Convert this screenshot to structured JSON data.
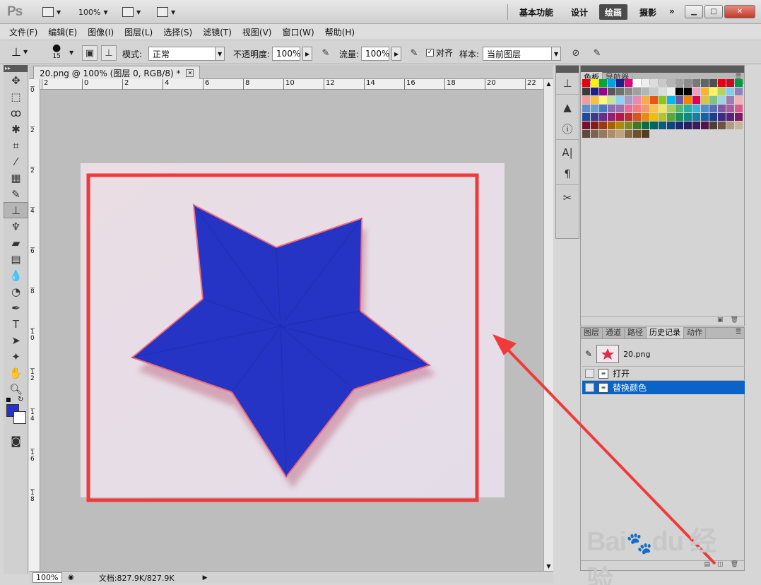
{
  "app": {
    "logo": "Ps",
    "zoom": "100%",
    "workspaces": [
      "基本功能",
      "设计",
      "绘画",
      "摄影"
    ],
    "active_workspace": "绘画",
    "more": "»"
  },
  "menu": [
    "文件(F)",
    "编辑(E)",
    "图像(I)",
    "图层(L)",
    "选择(S)",
    "滤镜(T)",
    "视图(V)",
    "窗口(W)",
    "帮助(H)"
  ],
  "options": {
    "brush_size": "15",
    "mode_label": "模式:",
    "mode_value": "正常",
    "opacity_label": "不透明度:",
    "opacity_value": "100%",
    "flow_label": "流量:",
    "flow_value": "100%",
    "aligned_label": "对齐",
    "sample_label": "样本:",
    "sample_value": "当前图层"
  },
  "document": {
    "tab_title": "20.png @ 100% (图层 0, RGB/8) *",
    "ruler_h": [
      "2",
      "0",
      "2",
      "4",
      "6",
      "8",
      "10",
      "12",
      "14",
      "16",
      "18",
      "20",
      "22"
    ],
    "ruler_v": [
      "0",
      "2",
      "2",
      "4",
      "6",
      "8",
      "1\n0",
      "1\n2",
      "1\n4",
      "1\n6",
      "1\n8"
    ],
    "status_zoom": "100%",
    "status_doc": "文档:827.9K/827.9K"
  },
  "panels": {
    "swatches_tabs": [
      "色板",
      "导航器"
    ],
    "history_tabs": [
      "图层",
      "通道",
      "路径",
      "历史记录",
      "动作"
    ],
    "snapshot_name": "20.png",
    "history_items": [
      "打开",
      "替换颜色"
    ],
    "selected_history": "替换颜色"
  },
  "swatch_colors": [
    "#e60012",
    "#fff100",
    "#00a73c",
    "#00a0e9",
    "#1d2088",
    "#e4007f",
    "#ffffff",
    "#eeeeee",
    "#dcdcdc",
    "#c9c9c9",
    "#b5b5b5",
    "#a0a0a0",
    "#8c8c8c",
    "#787878",
    "#646464",
    "#505050",
    "#e60012",
    "#c30d23",
    "#009944",
    "#3e3a39",
    "#1d2088",
    "#920783",
    "#595757",
    "#727171",
    "#898989",
    "#9fa0a0",
    "#b5b5b6",
    "#c9caca",
    "#dcdddd",
    "#efefef",
    "#000000",
    "#000000",
    "#f19ec2",
    "#f8b62d",
    "#fff45c",
    "#b3d465",
    "#7ecef4",
    "#8f82bc",
    "#f29c9f",
    "#fac03d",
    "#fff67f",
    "#c7e2a2",
    "#8cd3f5",
    "#a59aca",
    "#ee87b4",
    "#f6ad49",
    "#ea5514",
    "#8fc31f",
    "#00b7ee",
    "#6a5aa3",
    "#f08300",
    "#e5004f",
    "#d7c447",
    "#7cc28d",
    "#a3d2e2",
    "#9e7bb5",
    "#f5b2b2",
    "#5f8ec9",
    "#6a9fd1",
    "#4c7bbd",
    "#8a70b0",
    "#a06fae",
    "#e86b9a",
    "#f37c7c",
    "#f29a6c",
    "#fbc24f",
    "#f0e85a",
    "#a8cf58",
    "#57b770",
    "#2aaea5",
    "#38b5d8",
    "#4e8fcc",
    "#5b6db4",
    "#7b5aa6",
    "#a85b9f",
    "#d85a8e",
    "#1f4a9a",
    "#3d3a8f",
    "#6a2c8c",
    "#8e2471",
    "#b5184c",
    "#c72b2b",
    "#d9531e",
    "#e98b11",
    "#eebc0c",
    "#b8c224",
    "#5aa83a",
    "#16925a",
    "#0c8b85",
    "#137fa8",
    "#1b5f9f",
    "#243b8a",
    "#3d2b82",
    "#5a2379",
    "#7d1c63",
    "#7a0f2e",
    "#8a1a16",
    "#9a3a10",
    "#a5600a",
    "#a98b05",
    "#7d8c15",
    "#3e7a2a",
    "#0f6b46",
    "#08645f",
    "#0c5b7a",
    "#12437a",
    "#1a2b6b",
    "#2b1f66",
    "#401a5e",
    "#56144c",
    "#4f4035",
    "#6b5444",
    "#b59a7f",
    "#c9b49b",
    "#5c4a3c",
    "#7a634f",
    "#947a61",
    "#a98d6f",
    "#bfa27f",
    "#8a6a3e",
    "#6e5230",
    "#553c22"
  ]
}
